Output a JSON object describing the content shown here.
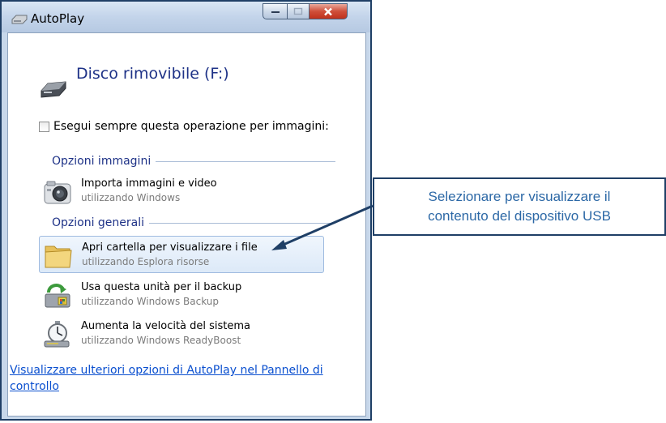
{
  "window": {
    "title": "AutoPlay",
    "drive_title": "Disco rimovibile (F:)",
    "checkbox": {
      "label": "Esegui sempre questa operazione per immagini:",
      "checked": false
    },
    "sections": [
      {
        "header": "Opzioni immagini"
      },
      {
        "header": "Opzioni generali"
      }
    ],
    "options": [
      {
        "title": "Importa immagini e video",
        "subtitle": "utilizzando Windows",
        "icon": "camera-icon"
      },
      {
        "title": "Apri cartella per visualizzare i file",
        "subtitle": "utilizzando Esplora risorse",
        "icon": "folder-icon",
        "selected": true
      },
      {
        "title": "Usa questa unità per il backup",
        "subtitle": "utilizzando Windows Backup",
        "icon": "backup-icon"
      },
      {
        "title": "Aumenta la velocità del sistema",
        "subtitle": "utilizzando Windows ReadyBoost",
        "icon": "stopwatch-icon"
      }
    ],
    "footer_link": "Visualizzare ulteriori opzioni di AutoPlay nel Pannello di controllo"
  },
  "callout": {
    "line1": "Selezionare per visualizzare il",
    "line2": "contenuto del dispositivo USB"
  },
  "colors": {
    "accent_blue": "#1e3287",
    "link": "#0a4fcf",
    "callout_text": "#2c68a6",
    "callout_border": "#1f3f66",
    "close_button": "#c0321d"
  }
}
